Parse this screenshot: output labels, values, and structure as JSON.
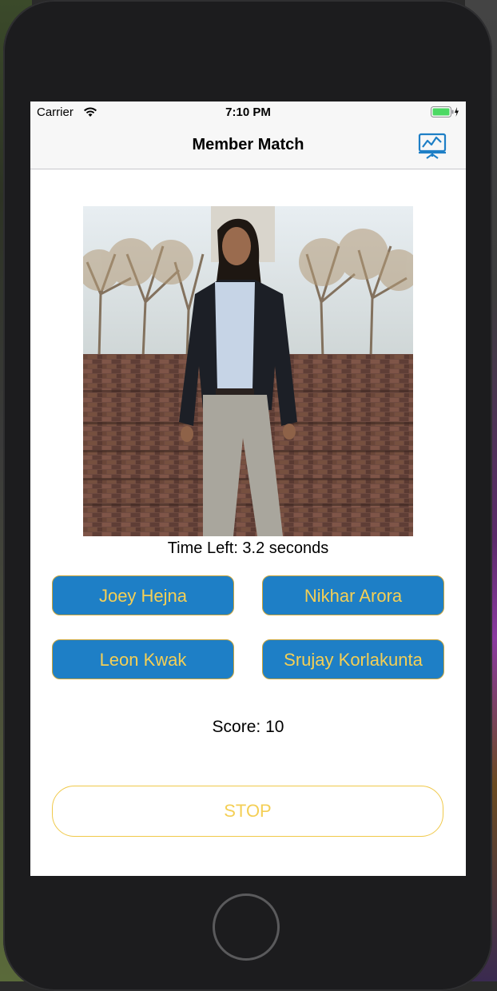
{
  "status_bar": {
    "carrier": "Carrier",
    "time": "7:10 PM",
    "icons": [
      "wifi-icon",
      "battery-icon"
    ]
  },
  "nav_bar": {
    "title": "Member Match",
    "right_icon": "stats-chart-icon"
  },
  "game": {
    "timer_text": "Time Left: 3.2 seconds",
    "answers": [
      "Joey Hejna",
      "Nikhar Arora",
      "Leon Kwak",
      "Srujay Korlakunta"
    ],
    "score_text": "Score: 10",
    "stop_label": "STOP"
  },
  "colors": {
    "accent_blue": "#1e7fc6",
    "accent_gold": "#f4cf55"
  }
}
